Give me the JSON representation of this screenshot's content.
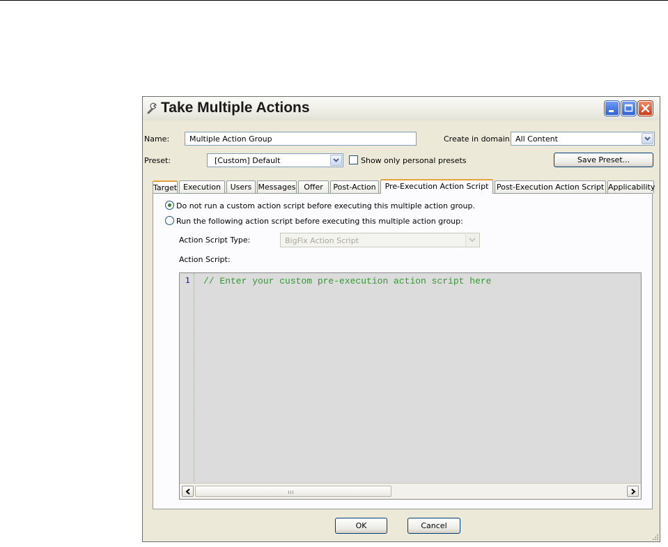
{
  "window": {
    "title": "Take Multiple Actions"
  },
  "form": {
    "name_label": "Name:",
    "name_value": "Multiple Action Group",
    "domain_label": "Create in domain:",
    "domain_value": "All Content",
    "preset_label": "Preset:",
    "preset_value": "[Custom] Default",
    "personal_presets_label": "Show only personal presets",
    "personal_presets_checked": false,
    "save_preset_label": "Save Preset..."
  },
  "tabs": [
    {
      "label": "Target"
    },
    {
      "label": "Execution"
    },
    {
      "label": "Users"
    },
    {
      "label": "Messages"
    },
    {
      "label": "Offer"
    },
    {
      "label": "Post-Action"
    },
    {
      "label": "Pre-Execution Action Script",
      "active": true
    },
    {
      "label": "Post-Execution Action Script"
    },
    {
      "label": "Applicability"
    }
  ],
  "panel": {
    "option_none": "Do not run a custom action script before executing this multiple action group.",
    "option_run": "Run the following action script before executing this multiple action group:",
    "selected_option": "none",
    "script_type_label": "Action Script Type:",
    "script_type_value": "BigFix Action Script",
    "action_script_label": "Action Script:",
    "editor": {
      "line_number": "1",
      "code": "// Enter your custom pre-execution action script here"
    }
  },
  "buttons": {
    "ok": "OK",
    "cancel": "Cancel"
  },
  "colors": {
    "code_comment": "#2f9a2f",
    "tab_accent": "#e6a13c",
    "dialog_bg": "#ece9d8"
  }
}
